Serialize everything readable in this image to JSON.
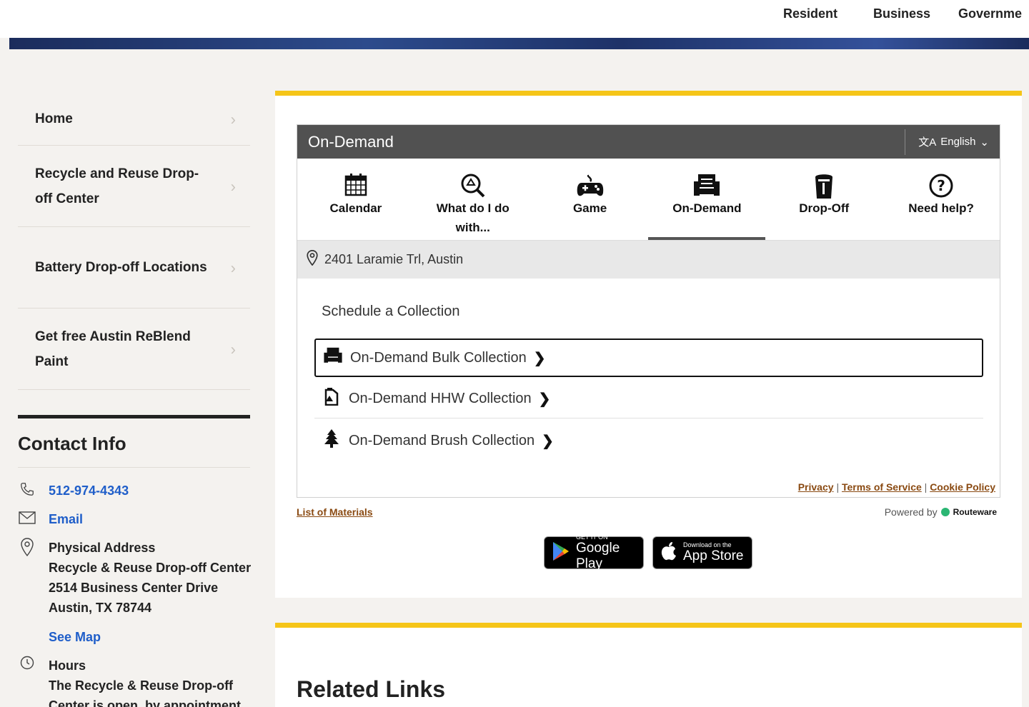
{
  "topnav": {
    "items": [
      "Resident",
      "Business",
      "Governme"
    ]
  },
  "sidebar": {
    "items": [
      {
        "label": "Home"
      },
      {
        "label": "Recycle and Reuse Drop-off Center"
      },
      {
        "label": "Battery Drop-off Locations"
      },
      {
        "label": "Get free Austin ReBlend Paint"
      }
    ]
  },
  "contact": {
    "title": "Contact Info",
    "phone": "512-974-4343",
    "email_label": "Email",
    "address_label": "Physical Address",
    "address_line1": "Recycle & Reuse Drop-off Center",
    "address_line2": "2514 Business Center Drive",
    "address_line3": "Austin, TX 78744",
    "map_label": "See Map",
    "hours_label": "Hours",
    "hours_line1": "The Recycle & Reuse Drop-off",
    "hours_line2": "Center is open, by appointment"
  },
  "widget": {
    "title": "On-Demand",
    "language": "English",
    "tabs": [
      {
        "label": "Calendar",
        "icon": "calendar-icon"
      },
      {
        "label": "What do I do with...",
        "icon": "recycle-search-icon"
      },
      {
        "label": "Game",
        "icon": "gamepad-icon"
      },
      {
        "label": "On-Demand",
        "icon": "armchair-icon",
        "active": true
      },
      {
        "label": "Drop-Off",
        "icon": "bin-icon"
      },
      {
        "label": "Need help?",
        "icon": "question-icon"
      }
    ],
    "address": "2401 Laramie Trl, Austin",
    "schedule_title": "Schedule a Collection",
    "collections": [
      {
        "label": "On-Demand Bulk Collection",
        "icon": "armchair-icon"
      },
      {
        "label": "On-Demand HHW Collection",
        "icon": "hazard-container-icon"
      },
      {
        "label": "On-Demand Brush Collection",
        "icon": "tree-icon"
      }
    ],
    "legal": {
      "privacy": "Privacy",
      "terms": "Terms of Service",
      "cookie": "Cookie Policy"
    }
  },
  "footer_links": {
    "list_materials": "List of Materials",
    "powered_by": "Powered by",
    "routeware": "Routeware"
  },
  "stores": {
    "google_small": "GET IT ON",
    "google_big": "Google Play",
    "apple_small": "Download on the",
    "apple_big": "App Store"
  },
  "related": {
    "title": "Related Links"
  }
}
